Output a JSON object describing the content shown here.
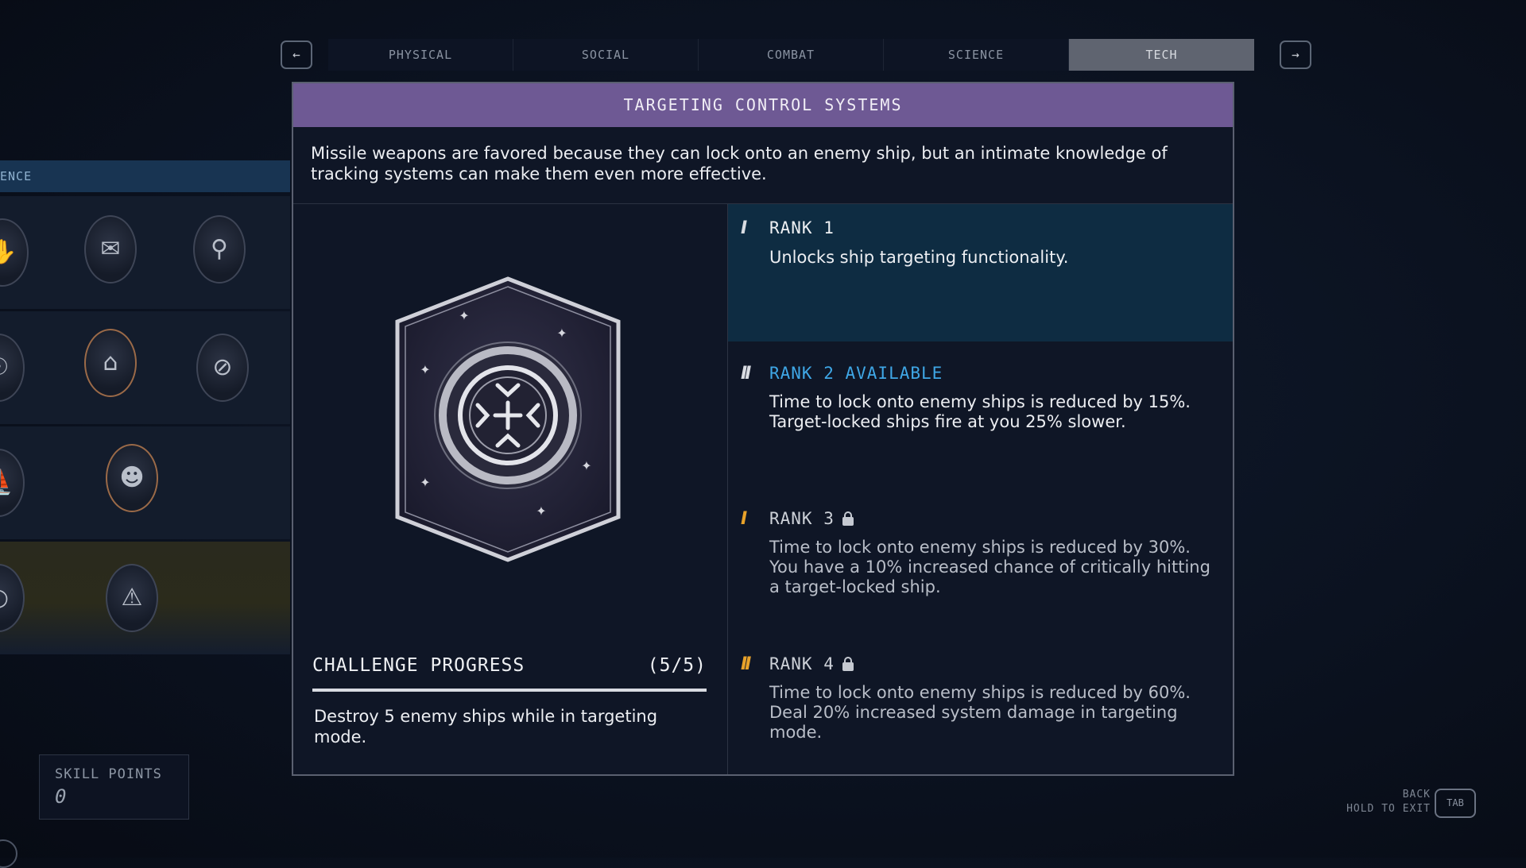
{
  "nav": {
    "prev_icon": "arrow-left-icon",
    "next_icon": "arrow-right-icon",
    "prev_glyph": "←",
    "next_glyph": "→",
    "tabs": [
      {
        "label": "PHYSICAL",
        "active": false
      },
      {
        "label": "SOCIAL",
        "active": false
      },
      {
        "label": "COMBAT",
        "active": false
      },
      {
        "label": "SCIENCE",
        "active": false
      },
      {
        "label": "TECH",
        "active": true
      }
    ]
  },
  "tree": {
    "header": "ENCE"
  },
  "skill": {
    "title": "TARGETING CONTROL SYSTEMS",
    "description": "Missile weapons are favored because they can lock onto an enemy ship, but an intimate knowledge of tracking systems can make them even more effective.",
    "emblem_icon": "targeting-reticle-icon",
    "challenge": {
      "title": "CHALLENGE PROGRESS",
      "count": "(5/5)",
      "progress": 1.0,
      "text": "Destroy 5 enemy ships while in targeting mode."
    },
    "ranks": [
      {
        "bars": "I",
        "label": "RANK 1",
        "text": "Unlocks ship targeting functionality.",
        "state": "unlocked",
        "bar_color": "#d9dce2"
      },
      {
        "bars": "II",
        "label": "RANK 2 AVAILABLE",
        "text": "Time to lock onto enemy ships is reduced by 15%. Target-locked ships fire at you 25% slower.",
        "state": "available",
        "bar_color": "#d9dce2",
        "label_color": "#3fa7e6"
      },
      {
        "bars": "I",
        "label": "RANK 3",
        "text": "Time to lock onto enemy ships is reduced by 30%. You have a 10% increased chance of critically hitting a target-locked ship.",
        "state": "locked",
        "bar_color": "#e8a22a"
      },
      {
        "bars": "II",
        "label": "RANK 4",
        "text": "Time to lock onto enemy ships is reduced by 60%. Deal 20% increased system damage in targeting mode.",
        "state": "locked",
        "bar_color": "#e8a22a"
      }
    ]
  },
  "skill_points": {
    "label": "SKILL POINTS",
    "value": "0"
  },
  "controls": {
    "back": "BACK",
    "hold_to_exit": "HOLD TO EXIT",
    "key": "TAB"
  },
  "colors": {
    "title_bar": "#6e5994",
    "rank1_bg": "#0e2c42",
    "available": "#3fa7e6",
    "locked_accent": "#e8a22a"
  }
}
